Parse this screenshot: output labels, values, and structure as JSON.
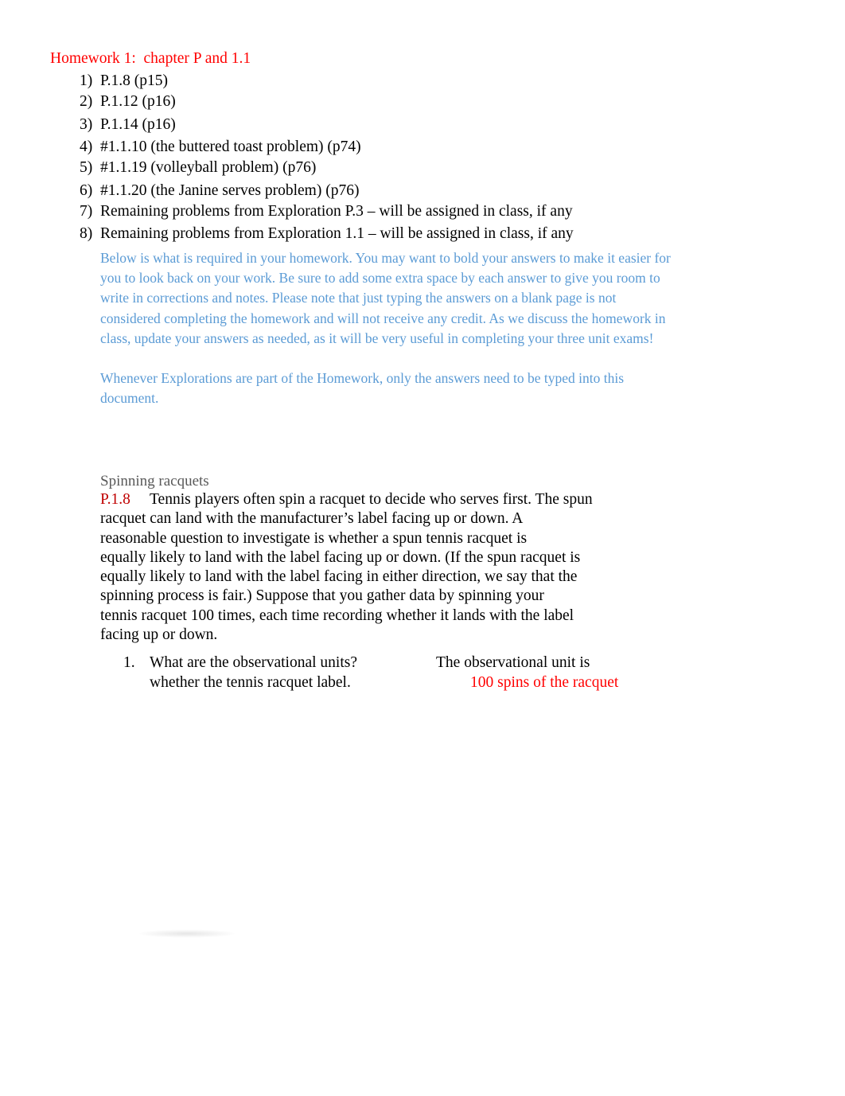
{
  "homework": {
    "title": "Homework 1:  chapter P and 1.1",
    "items": [
      {
        "num": "1)",
        "text": "P.1.8 (p15)"
      },
      {
        "num": "2)",
        "text": "P.1.12 (p16)"
      },
      {
        "num": "3)",
        "text": "P.1.14 (p16)"
      },
      {
        "num": "4)",
        "text": "#1.1.10 (the buttered toast problem) (p74)"
      },
      {
        "num": "5)",
        "text": "#1.1.19 (volleyball problem) (p76)"
      },
      {
        "num": "6)",
        "text": "#1.1.20 (the Janine serves problem) (p76)"
      },
      {
        "num": "7)",
        "text": "Remaining problems from Exploration P.3 – will be assigned in class, if any"
      },
      {
        "num": "8)",
        "text": "Remaining problems from Exploration 1.1 – will be assigned in class, if any"
      }
    ]
  },
  "instructions": {
    "paragraph1": "Below is what is required in your homework. You may want to bold your answers to make it easier for\nyou to look back on your work.  Be sure to add some extra space   by each answer to give you room to\nwrite in corrections and notes. Please note that just typing the answers on a blank page is not\nconsidered completing the homework and will not receive any credit. As we discuss the homework in\nclass, update your answers as needed, as it will be very useful in completing your three unit exams!",
    "paragraph2": "Whenever Explorations are part of the Homework,    only the answers  need to be typed into this\ndocument."
  },
  "problem": {
    "section_title": "Spinning racquets",
    "id": "P.1.8",
    "lines": [
      "Tennis players often spin a racquet to decide who serves first. The spun",
      "racquet can land with the manufacturer’s label facing up or down. A",
      "reasonable question to investigate is whether a spun tennis racquet is",
      "equally likely to land with the label facing up or down. (If the spun racquet is",
      "equally likely to land with the label facing in either direction, we say that the",
      "spinning process is fair.) Suppose that you gather data by spinning your",
      "tennis racquet 100 times, each time recording whether it lands with the label",
      "facing up or down."
    ],
    "question": {
      "number": "1.",
      "text_line1": "What are the observational units?",
      "text_line2": "whether the tennis racquet label.",
      "answer_line1": "The observational unit is",
      "answer_line2": "100 spins of the racquet"
    }
  },
  "colors": {
    "heading_red": "#ff0000",
    "problem_id_red": "#c00000",
    "instruction_blue": "#5b9bd5",
    "section_gray": "#595959",
    "answer_red": "#ff0000"
  }
}
